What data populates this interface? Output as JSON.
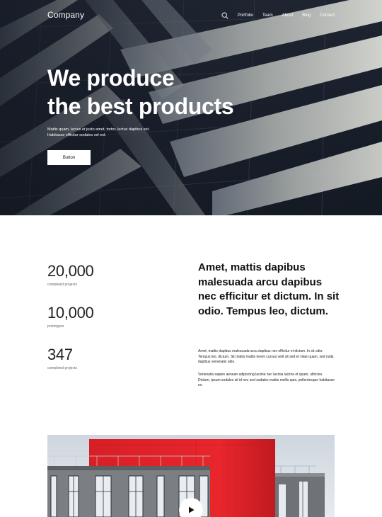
{
  "brand": {
    "name": "Company"
  },
  "nav": {
    "search_icon": "search-icon",
    "items": [
      {
        "label": "Portfolio"
      },
      {
        "label": "Team"
      },
      {
        "label": "About"
      },
      {
        "label": "Blog"
      },
      {
        "label": "Contact"
      }
    ]
  },
  "hero": {
    "title_line1": "We produce",
    "title_line2": "the best products",
    "text": "Mattis quam, lectus et justo amet, tortor, lectus dapibus est. Habitasse efficitur sodales vel est.",
    "button_label": "Button"
  },
  "stats": [
    {
      "value": "20,000",
      "label": "completed projects"
    },
    {
      "value": "10,000",
      "label": "prototypes"
    },
    {
      "value": "347",
      "label": "completed projects"
    }
  ],
  "feature": {
    "headline": "Amet, mattis dapibus malesuada arcu dapibus nec efficitur et dictum. In sit odio. Tempus leo, dictum.",
    "paragraph1": "Amet, mattis dapibus malesuada arcu dapibus nec efficitur et dictum. In sit odio. Tempus leo, dictum. Sit mattis mattis lorem cursus velit sit sed et vitae quam, sed nulla dapibus venenatis odio.",
    "paragraph2": "Venenatis sapien aenean adipiscing lacinia nec lacinia lacinia et quam, ultricies. Dictum, ipsum sodales sit id nec sed sodales mattis mollis quis, pellentesque habitasse ex."
  },
  "media": {
    "play_icon": "play-icon"
  },
  "colors": {
    "hero_overlay": "#1d2330",
    "accent_red": "#e0242a",
    "text_dark": "#111111",
    "white": "#ffffff"
  }
}
